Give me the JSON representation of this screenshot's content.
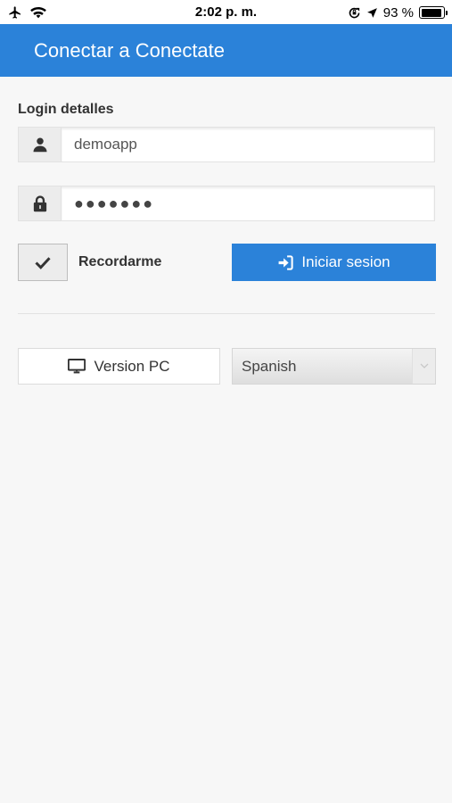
{
  "status_bar": {
    "time": "2:02 p. m.",
    "battery_text": "93 %",
    "battery_level": 0.93,
    "icons": [
      "airplane-icon",
      "wifi-icon",
      "orientation-lock-icon",
      "location-arrow-icon",
      "battery-icon"
    ]
  },
  "app_bar": {
    "title": "Conectar a Conectate",
    "color": "#2b82d9"
  },
  "login": {
    "section_label": "Login detalles",
    "username": {
      "value": "demoapp",
      "icon": "user-icon"
    },
    "password": {
      "value": "●●●●●●●",
      "icon": "lock-icon"
    },
    "remember": {
      "label": "Recordarme",
      "checked": true
    },
    "submit": {
      "label": "Iniciar sesion",
      "icon": "sign-in-icon"
    }
  },
  "footer": {
    "pc_version": {
      "label": "Version PC",
      "icon": "desktop-icon"
    },
    "language": {
      "selected": "Spanish"
    }
  }
}
